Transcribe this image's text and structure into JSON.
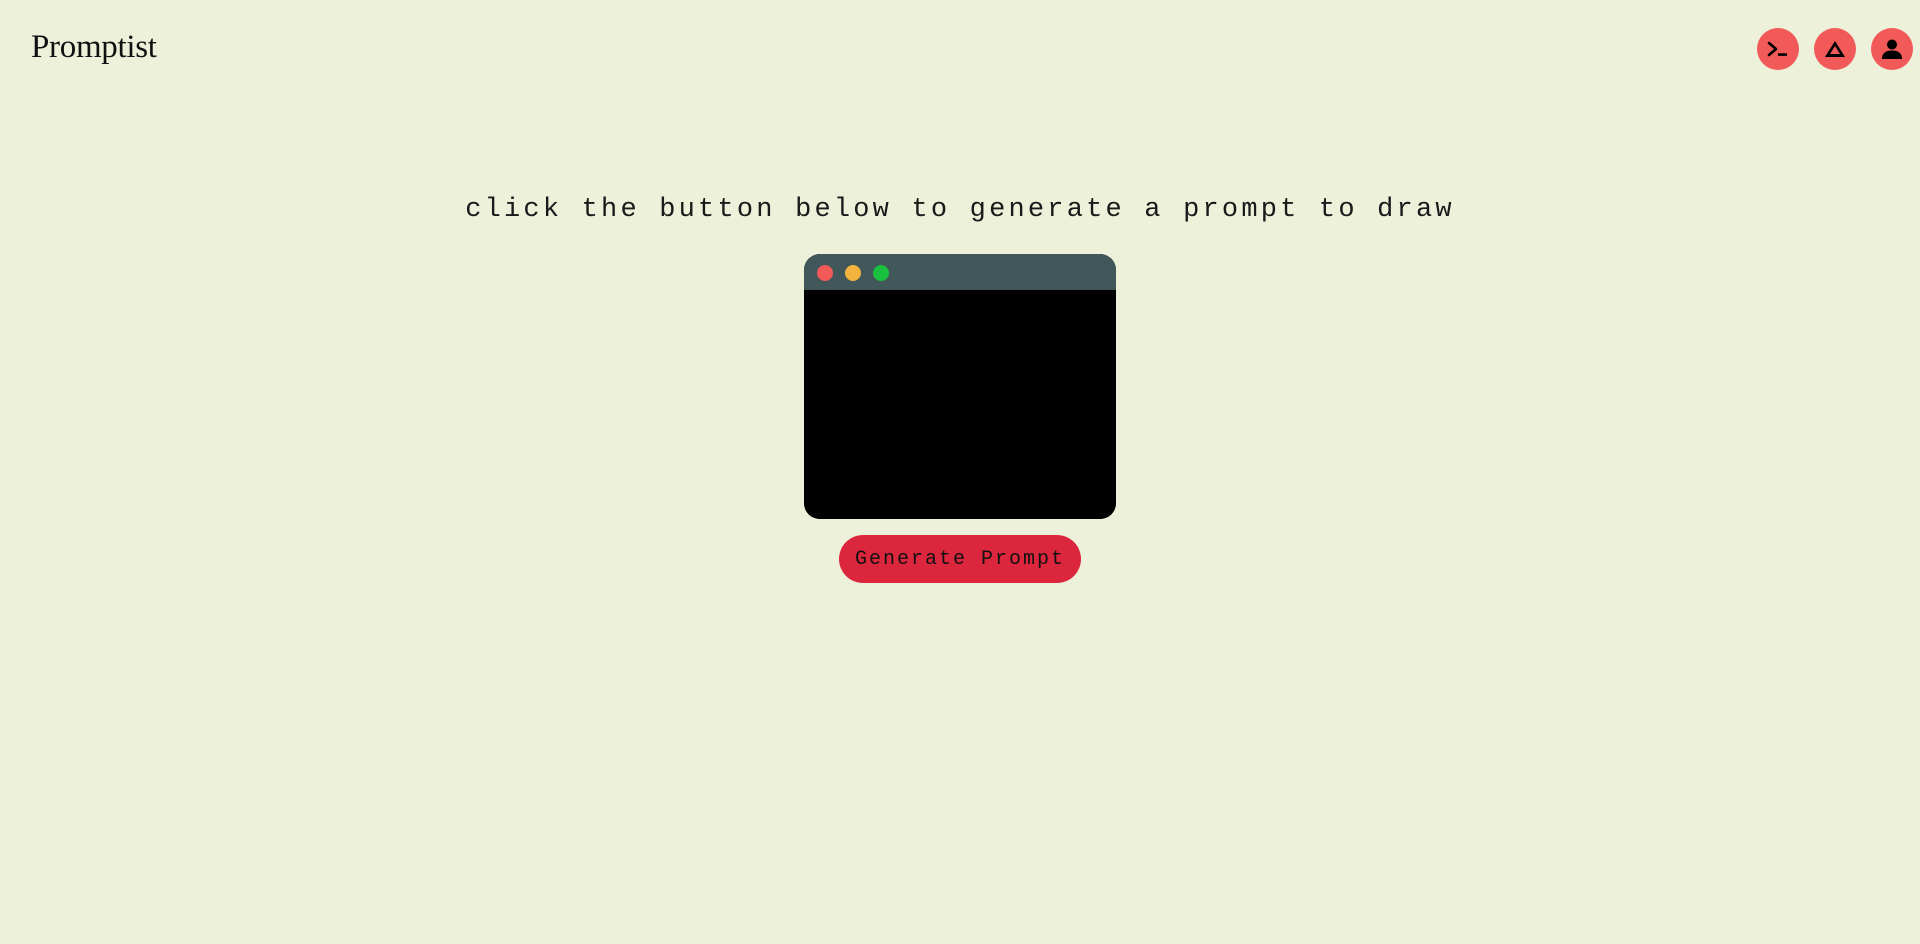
{
  "header": {
    "logo": "Promptist",
    "nav": [
      {
        "name": "terminal-icon"
      },
      {
        "name": "gallery-icon"
      },
      {
        "name": "user-icon"
      }
    ]
  },
  "main": {
    "instruction": "click the button below to generate a prompt to draw",
    "prompt_text": "",
    "generate_label": "Generate Prompt"
  },
  "colors": {
    "background": "#edf1da",
    "accent": "#f25a5a",
    "button": "#dc263d",
    "window_bar": "#41575a",
    "dot_red": "#f25a5a",
    "dot_yellow": "#f4b23e",
    "dot_green": "#19bf3e"
  }
}
